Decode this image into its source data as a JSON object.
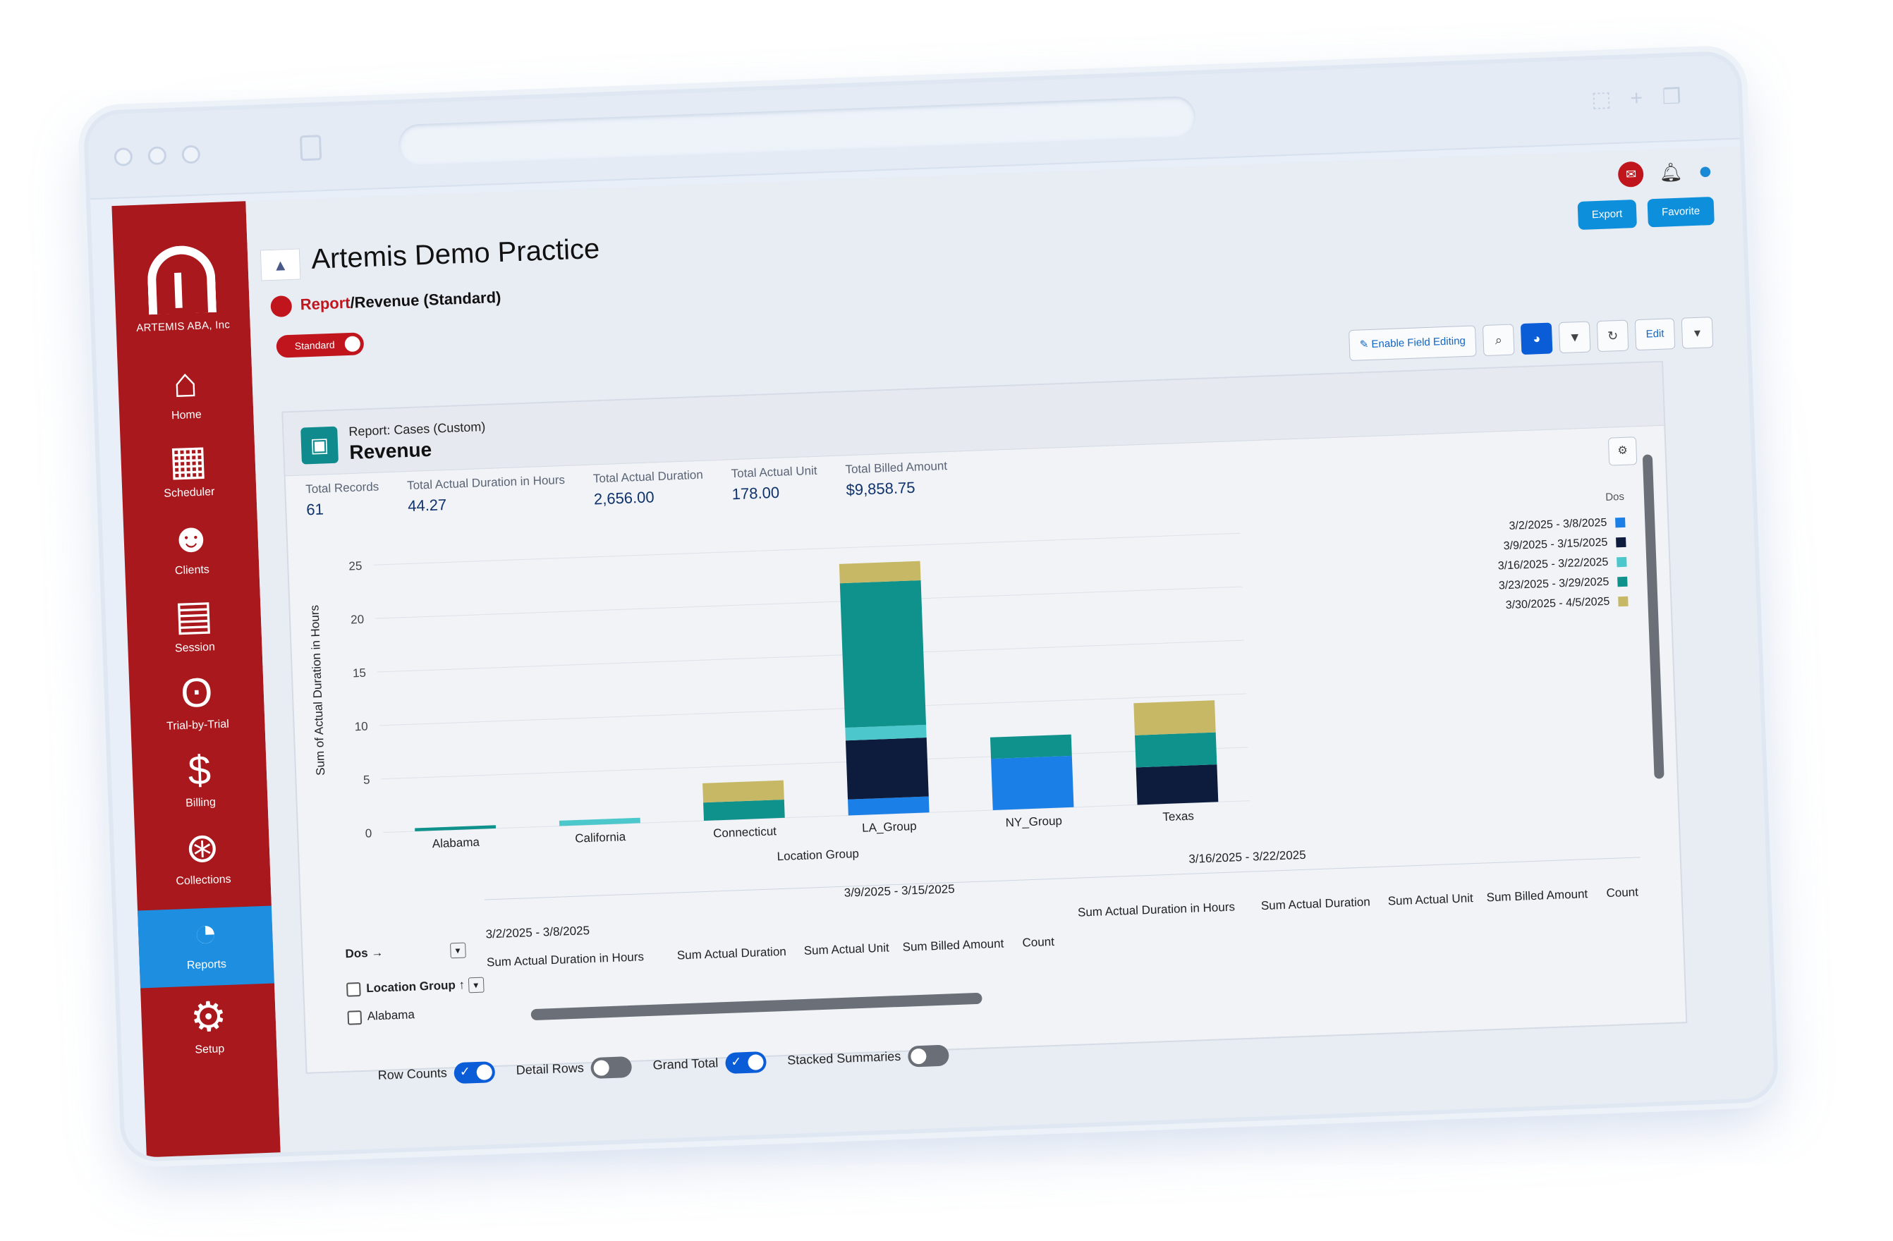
{
  "sidebar": {
    "brand": "ARTEMIS ABA, Inc",
    "items": [
      {
        "label": "Home",
        "icon": "home-icon"
      },
      {
        "label": "Scheduler",
        "icon": "calendar-icon"
      },
      {
        "label": "Clients",
        "icon": "people-icon"
      },
      {
        "label": "Session",
        "icon": "session-icon"
      },
      {
        "label": "Trial-by-Trial",
        "icon": "footprints-icon"
      },
      {
        "label": "Billing",
        "icon": "dollar-icon"
      },
      {
        "label": "Collections",
        "icon": "collections-icon"
      },
      {
        "label": "Reports",
        "icon": "pie-chart-icon",
        "active": true
      },
      {
        "label": "Setup",
        "icon": "gear-icon"
      }
    ]
  },
  "header": {
    "practice_name": "Artemis Demo Practice",
    "export_label": "Export",
    "favorite_label": "Favorite",
    "breadcrumb_root": "Report",
    "breadcrumb_page": "/Revenue (Standard)",
    "toggle_label": "Standard"
  },
  "toolbar": {
    "enable_editing_label": "Enable Field Editing",
    "edit_label": "Edit"
  },
  "report": {
    "subtitle": "Report: Cases (Custom)",
    "title": "Revenue",
    "totals": [
      {
        "label": "Total Records",
        "value": "61"
      },
      {
        "label": "Total Actual Duration in Hours",
        "value": "44.27"
      },
      {
        "label": "Total Actual Duration",
        "value": "2,656.00"
      },
      {
        "label": "Total Actual Unit",
        "value": "178.00"
      },
      {
        "label": "Total Billed Amount",
        "value": "$9,858.75"
      }
    ]
  },
  "chart_data": {
    "type": "bar",
    "stacked": true,
    "xlabel": "Location Group",
    "ylabel": "Sum of Actual Duration in Hours",
    "ylim": [
      0,
      27
    ],
    "yticks": [
      0,
      5,
      10,
      15,
      20,
      25
    ],
    "categories": [
      "Alabama",
      "California",
      "Connecticut",
      "LA_Group",
      "NY_Group",
      "Texas"
    ],
    "legend_title": "Dos",
    "legend_position": "top-right",
    "series": [
      {
        "name": "3/2/2025 - 3/8/2025",
        "color": "#1a7fe6",
        "values": [
          0,
          0,
          0,
          1.5,
          4.8,
          0
        ]
      },
      {
        "name": "3/9/2025 - 3/15/2025",
        "color": "#0d1b3d",
        "values": [
          0,
          0,
          0,
          5.5,
          0,
          3.5
        ]
      },
      {
        "name": "3/16/2025 - 3/22/2025",
        "color": "#4cc8cc",
        "values": [
          0,
          0.5,
          0,
          1.2,
          0,
          0
        ]
      },
      {
        "name": "3/23/2025 - 3/29/2025",
        "color": "#0f918c",
        "values": [
          0.3,
          0,
          1.7,
          13.5,
          2.0,
          3.0
        ]
      },
      {
        "name": "3/30/2025 - 4/5/2025",
        "color": "#c7b866",
        "values": [
          0,
          0,
          1.8,
          1.8,
          0,
          3.0
        ]
      }
    ]
  },
  "pivot": {
    "dos_label": "Dos",
    "location_group_label": "Location Group",
    "row_label": "Alabama",
    "groups": [
      {
        "label": "3/2/2025 - 3/8/2025"
      },
      {
        "label": "3/9/2025 - 3/15/2025"
      },
      {
        "label": "3/16/2025 - 3/22/2025"
      }
    ],
    "columns": [
      "Sum Actual Duration in Hours",
      "Sum Actual Duration",
      "Sum Actual Unit",
      "Sum Billed Amount",
      "Count"
    ],
    "options": {
      "row_counts": "Row Counts",
      "detail_rows": "Detail Rows",
      "grand_total": "Grand Total",
      "stacked_summaries": "Stacked Summaries"
    }
  }
}
